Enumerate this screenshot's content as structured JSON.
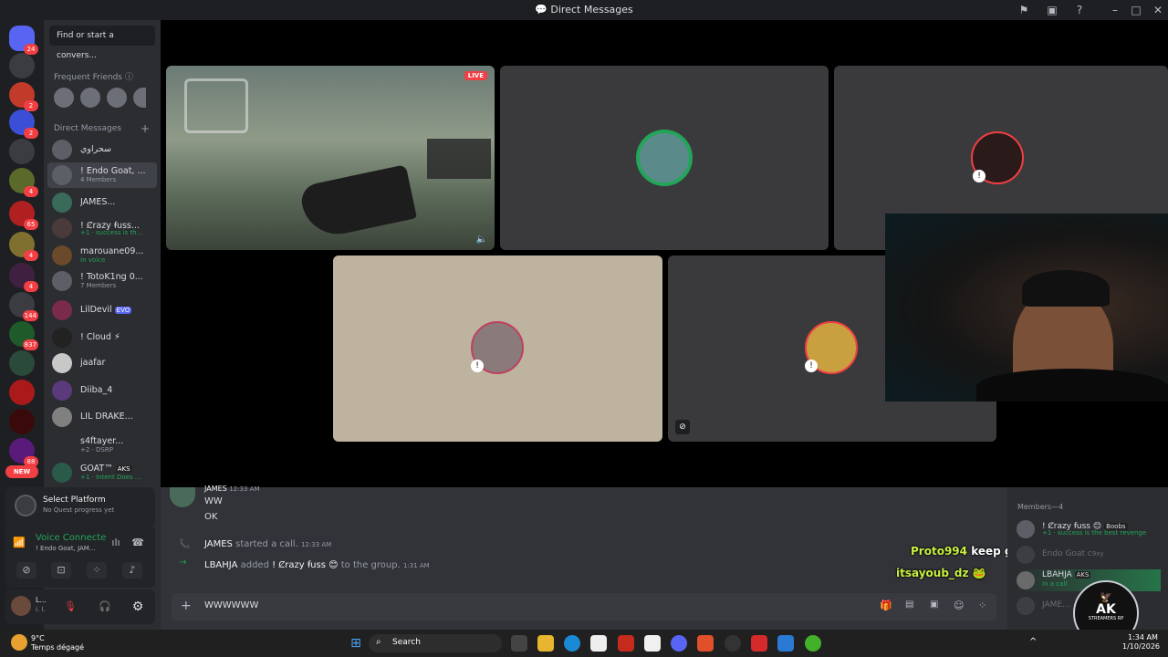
{
  "window": {
    "title": "Direct Messages"
  },
  "rail": {
    "badges": [
      "24",
      "2",
      "2",
      "4",
      "4",
      "65",
      "4",
      "144",
      "837",
      "28",
      "88"
    ],
    "new_label": "NEW"
  },
  "dm": {
    "search_placeholder": "Find or start a convers...",
    "frequent_friends_label": "Frequent Friends",
    "direct_messages_label": "Direct Messages",
    "add_icon": "plus-icon",
    "items": [
      {
        "name": "سحراوي",
        "sub": ""
      },
      {
        "name": "! Endo Goat, ...",
        "sub": "4 Members"
      },
      {
        "name": "JAMES...",
        "sub": ""
      },
      {
        "name": "! Ȼrazy ꞙuss...",
        "sub": "+1 · success is th..."
      },
      {
        "name": "marouane09...",
        "sub": "In voice"
      },
      {
        "name": "! TotoK1ng 0...",
        "sub": "7 Members"
      },
      {
        "name": "LilDevil",
        "sub": "",
        "tag": "EVO"
      },
      {
        "name": "! Cloud ⚡",
        "sub": ""
      },
      {
        "name": "jaafar",
        "sub": ""
      },
      {
        "name": "Diiba_4",
        "sub": ""
      },
      {
        "name": "LIL DRAKE...",
        "sub": ""
      },
      {
        "name": "s4ftayer...",
        "sub": "+2 · DSRP"
      },
      {
        "name": "GOAT™",
        "sub": "+1 · Intent Does ...",
        "tag": "AKS"
      }
    ]
  },
  "quest": {
    "title": "Select Platform",
    "subtitle": "No Quest progress yet"
  },
  "voice": {
    "status": "Voice Connecte",
    "channel": "! Endo Goat, JAM..."
  },
  "user": {
    "name": "L...",
    "status": "i. l."
  },
  "call": {
    "live_label": "LIVE"
  },
  "chat": {
    "messages": [
      {
        "author": "JAMES",
        "time": "12:33 AM",
        "lines": [
          "WW",
          "OK"
        ]
      },
      {
        "type": "call",
        "author": "JAMES",
        "text": "started a call.",
        "time": "12:33 AM"
      },
      {
        "type": "add",
        "author": "LBAHJA",
        "text1": "added",
        "target": "! Ȼrazy ꞙuss 😊",
        "text2": "to the group.",
        "time": "1:31 AM"
      }
    ],
    "composer_value": "WWWWWW"
  },
  "overlay": {
    "line1_user": "Proto994",
    "line1_text": "keep goingggg",
    "line2_user": "itsayoub_dz"
  },
  "members": {
    "header": "Members—4",
    "items": [
      {
        "name": "! Ȼrazy ꞙuss 😊",
        "tag": "Boobs",
        "sub": "+1 · success is the best revenge"
      },
      {
        "name": "Endo Goat",
        "tag": "C9xy",
        "sub": ""
      },
      {
        "name": "LBAHJA",
        "tag": "AKS",
        "sub": "In a call"
      },
      {
        "name": "JAME...",
        "tag": "",
        "sub": ""
      }
    ]
  },
  "logo": {
    "text": "AK",
    "subtext": "STREAMERS RP"
  },
  "taskbar": {
    "weather_temp": "9°C",
    "weather_desc": "Temps dégagé",
    "search_label": "Search",
    "time": "1:34 AM",
    "date": "1/10/2026"
  }
}
